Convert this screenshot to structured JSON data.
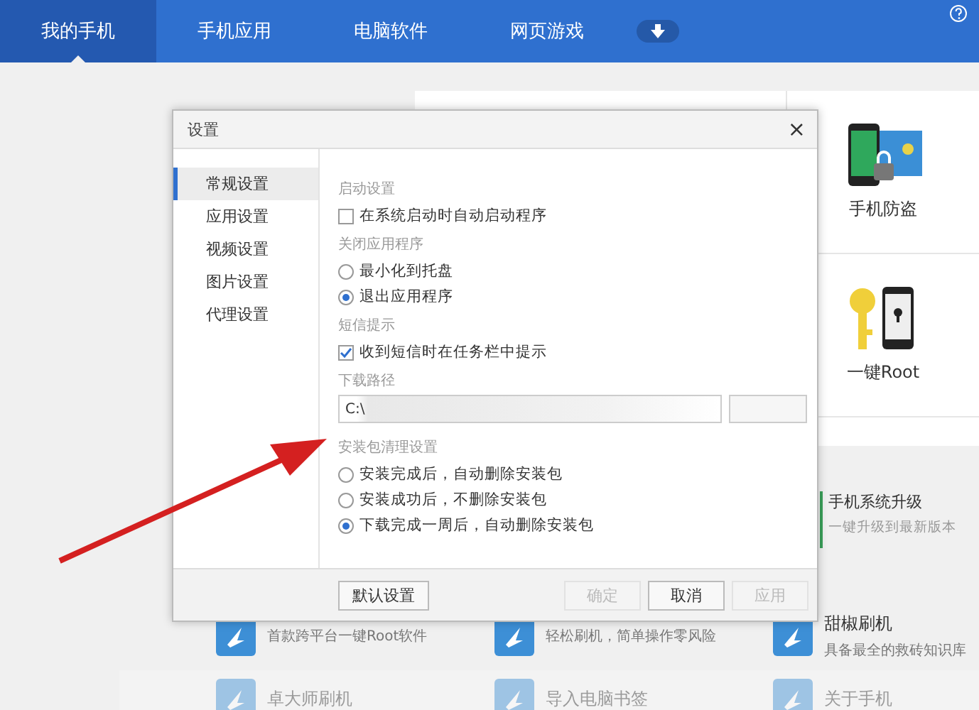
{
  "nav": {
    "tabs": [
      {
        "label": "我的手机",
        "selected": true
      },
      {
        "label": "手机应用",
        "selected": false
      },
      {
        "label": "电脑软件",
        "selected": false
      },
      {
        "label": "网页游戏",
        "selected": false
      }
    ]
  },
  "feature_cards": [
    {
      "label": "手机防盗",
      "kind": "antitheft"
    },
    {
      "label": "一键Root",
      "kind": "root"
    }
  ],
  "upgrade": {
    "title": "手机系统升级",
    "subtitle": "一键升级到最新版本"
  },
  "tool_rows": [
    {
      "dimmed": false,
      "items": [
        {
          "subtitle": "首款跨平台一键Root软件"
        },
        {
          "subtitle": "轻松刷机，简单操作零风险"
        },
        {
          "title": "甜椒刷机",
          "subtitle": "具备最全的救砖知识库"
        }
      ]
    },
    {
      "dimmed": true,
      "items": [
        {
          "title": "卓大师刷机"
        },
        {
          "title": "导入电脑书签"
        },
        {
          "title": "关于手机"
        }
      ]
    }
  ],
  "dialog": {
    "title": "设置",
    "close": "×",
    "sidebar": [
      {
        "label": "常规设置",
        "selected": true
      },
      {
        "label": "应用设置",
        "selected": false
      },
      {
        "label": "视频设置",
        "selected": false
      },
      {
        "label": "图片设置",
        "selected": false
      },
      {
        "label": "代理设置",
        "selected": false
      }
    ],
    "sections": [
      {
        "heading": "启动设置",
        "kind": "checkbox",
        "options": [
          {
            "label": "在系统启动时自动启动程序",
            "checked": false
          }
        ]
      },
      {
        "heading": "关闭应用程序",
        "kind": "radio",
        "options": [
          {
            "label": "最小化到托盘",
            "selected": false
          },
          {
            "label": "退出应用程序",
            "selected": true
          }
        ]
      },
      {
        "heading": "短信提示",
        "kind": "checkbox",
        "options": [
          {
            "label": "收到短信时在任务栏中提示",
            "checked": true
          }
        ]
      },
      {
        "heading": "下载路径",
        "kind": "path",
        "value": "C:\\"
      },
      {
        "heading": "安装包清理设置",
        "kind": "radio",
        "options": [
          {
            "label": "安装完成后，自动删除安装包",
            "selected": false
          },
          {
            "label": "安装成功后，不删除安装包",
            "selected": false
          },
          {
            "label": "下载完成一周后，自动删除安装包",
            "selected": true
          }
        ]
      }
    ],
    "buttons": [
      {
        "label": "默认设置",
        "disabled": false,
        "kind": "left"
      },
      {
        "label": "确定",
        "disabled": true,
        "kind": "right"
      },
      {
        "label": "取消",
        "disabled": false,
        "kind": "right"
      },
      {
        "label": "应用",
        "disabled": true,
        "kind": "right"
      }
    ]
  }
}
